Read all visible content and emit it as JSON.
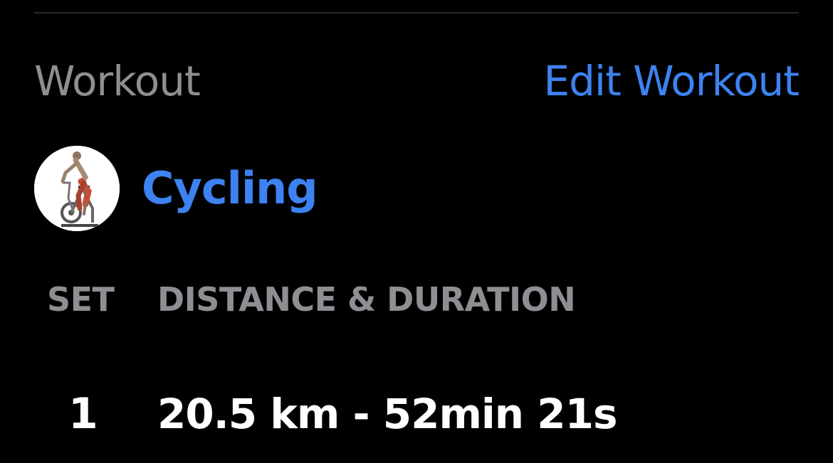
{
  "header": {
    "title": "Workout",
    "edit_label": "Edit Workout"
  },
  "exercise": {
    "name": "Cycling",
    "icon": "stationary-bike-icon"
  },
  "table": {
    "columns": [
      "SET",
      "DISTANCE & DURATION"
    ],
    "rows": [
      {
        "set": "1",
        "value": "20.5 km - 52min 21s"
      }
    ]
  },
  "colors": {
    "background": "#000000",
    "accent": "#3d82f0",
    "muted_text": "#8e8e93",
    "primary_text": "#ffffff"
  }
}
